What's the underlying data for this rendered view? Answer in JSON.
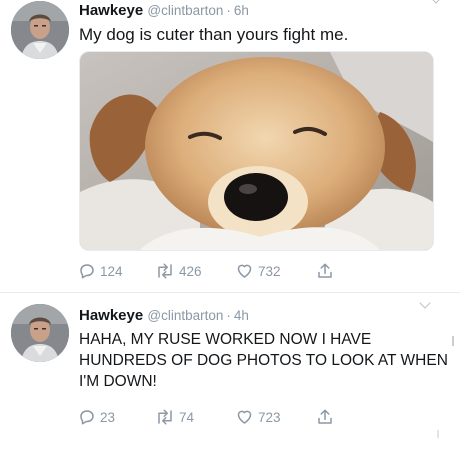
{
  "tweets": [
    {
      "name": "Hawkeye",
      "handle": "@clintbarton",
      "separator": "·",
      "time": "6h",
      "text": "My dog is cuter than yours fight me.",
      "stats": {
        "replies": "124",
        "retweets": "426",
        "likes": "732"
      }
    },
    {
      "name": "Hawkeye",
      "handle": "@clintbarton",
      "separator": "·",
      "time": "4h",
      "text": "HAHA, MY RUSE WORKED NOW I HAVE HUNDREDS OF DOG PHOTOS TO LOOK AT WHEN I'M DOWN!",
      "stats": {
        "replies": "23",
        "retweets": "74",
        "likes": "723"
      }
    }
  ],
  "icons": {
    "reply": "reply-icon",
    "retweet": "retweet-icon",
    "like": "heart-icon",
    "share": "share-icon",
    "menu": "chevron-down-icon"
  },
  "colors": {
    "text": "#14171a",
    "secondary": "#8b98a5",
    "divider": "#e6ecf0"
  }
}
